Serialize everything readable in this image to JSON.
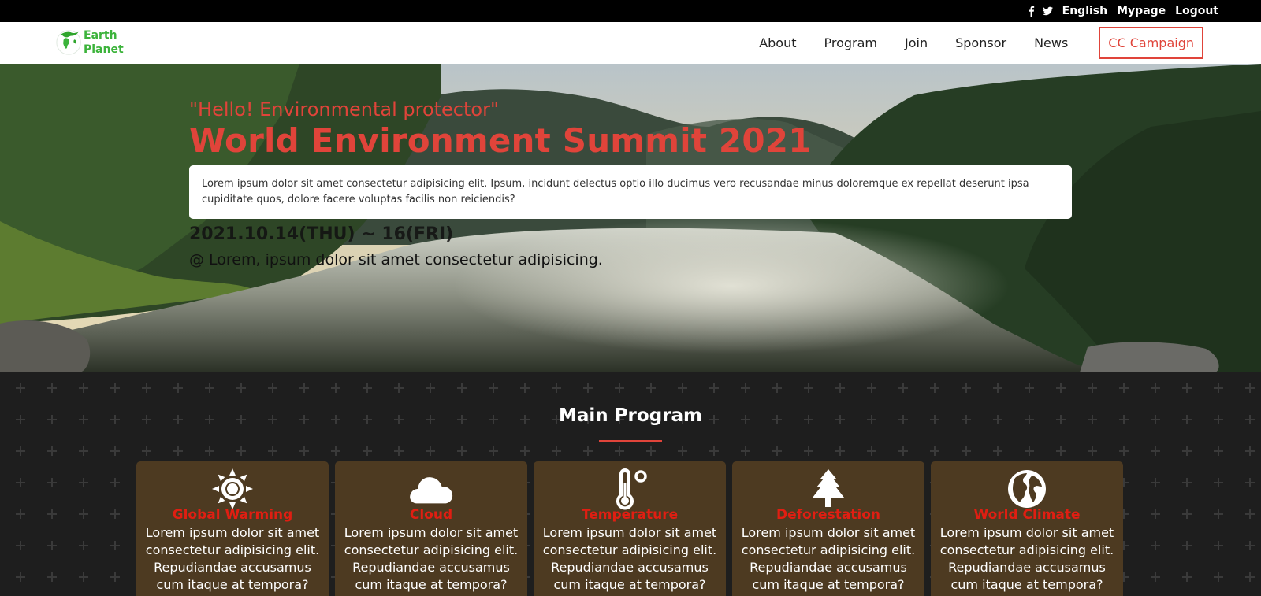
{
  "topbar": {
    "social": [
      "facebook-icon",
      "twitter-icon"
    ],
    "links": [
      "English",
      "Mypage",
      "Logout"
    ]
  },
  "header": {
    "logo_line1": "Earth",
    "logo_line2": "Planet",
    "nav": [
      "About",
      "Program",
      "Join",
      "Sponsor",
      "News"
    ],
    "campaign": "CC Campaign"
  },
  "hero": {
    "tagline": "\"Hello! Environmental protector\"",
    "title": "World Environment Summit 2021",
    "description": "Lorem ipsum dolor sit amet consectetur adipisicing elit. Ipsum, incidunt delectus optio illo ducimus vero recusandae minus doloremque ex repellat deserunt ipsa cupiditate quos, dolore facere voluptas facilis non reiciendis?",
    "dates": "2021.10.14(THU) ~ 16(FRI)",
    "venue": "@ Lorem, ipsum dolor sit amet consectetur adipisicing."
  },
  "program": {
    "heading": "Main Program",
    "cards": [
      {
        "icon": "sun-icon",
        "title": "Global Warming",
        "body": "Lorem ipsum dolor sit amet consectetur adipisicing elit. Repudiandae accusamus cum itaque at tempora?"
      },
      {
        "icon": "cloud-icon",
        "title": "Cloud",
        "body": "Lorem ipsum dolor sit amet consectetur adipisicing elit. Repudiandae accusamus cum itaque at tempora?"
      },
      {
        "icon": "thermometer-icon",
        "title": "Temperature",
        "body": "Lorem ipsum dolor sit amet consectetur adipisicing elit. Repudiandae accusamus cum itaque at tempora?"
      },
      {
        "icon": "tree-icon",
        "title": "Deforestation",
        "body": "Lorem ipsum dolor sit amet consectetur adipisicing elit. Repudiandae accusamus cum itaque at tempora?"
      },
      {
        "icon": "globe-icon",
        "title": "World Climate",
        "body": "Lorem ipsum dolor sit amet consectetur adipisicing elit. Repudiandae accusamus cum itaque at tempora?"
      }
    ]
  },
  "colors": {
    "accent": "#e0443a",
    "logo_green": "#3cb33b",
    "card_bg": "#4d3a21",
    "card_title": "#e01e12"
  }
}
